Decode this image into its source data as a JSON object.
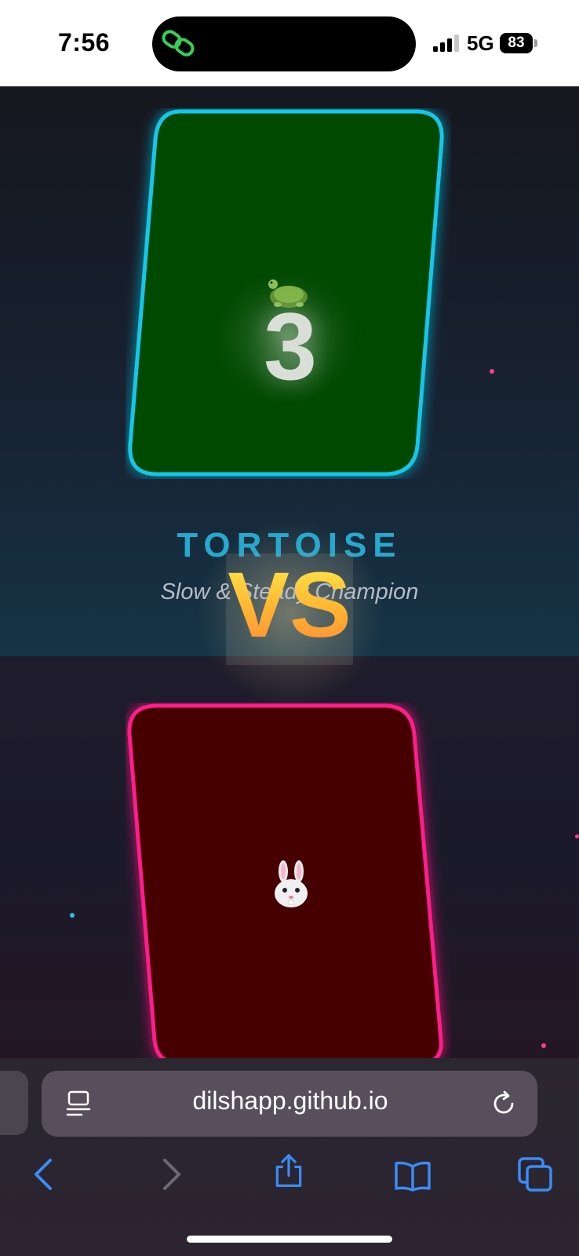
{
  "status": {
    "time": "7:56",
    "network": "5G",
    "battery": "83"
  },
  "game": {
    "countdown": "3",
    "player_title": "TORTOISE",
    "player_subtitle": "Slow & Steady Champion",
    "vs_label": "VS",
    "player_icon": "turtle-icon",
    "opponent_icon": "rabbit-icon",
    "colors": {
      "player_border": "#19c6ea",
      "player_fill": "#034a06",
      "opponent_border": "#ff1a8c",
      "opponent_fill": "#470000",
      "title": "#27a9cf"
    }
  },
  "browser": {
    "url": "dilshapp.github.io",
    "icons": {
      "reader": "reader-mode-icon",
      "reload": "reload-icon",
      "back": "back-chevron-icon",
      "forward": "forward-chevron-icon",
      "share": "share-icon",
      "bookmarks": "bookmarks-icon",
      "tabs": "tabs-icon"
    },
    "accent": "#3b8cf5"
  }
}
